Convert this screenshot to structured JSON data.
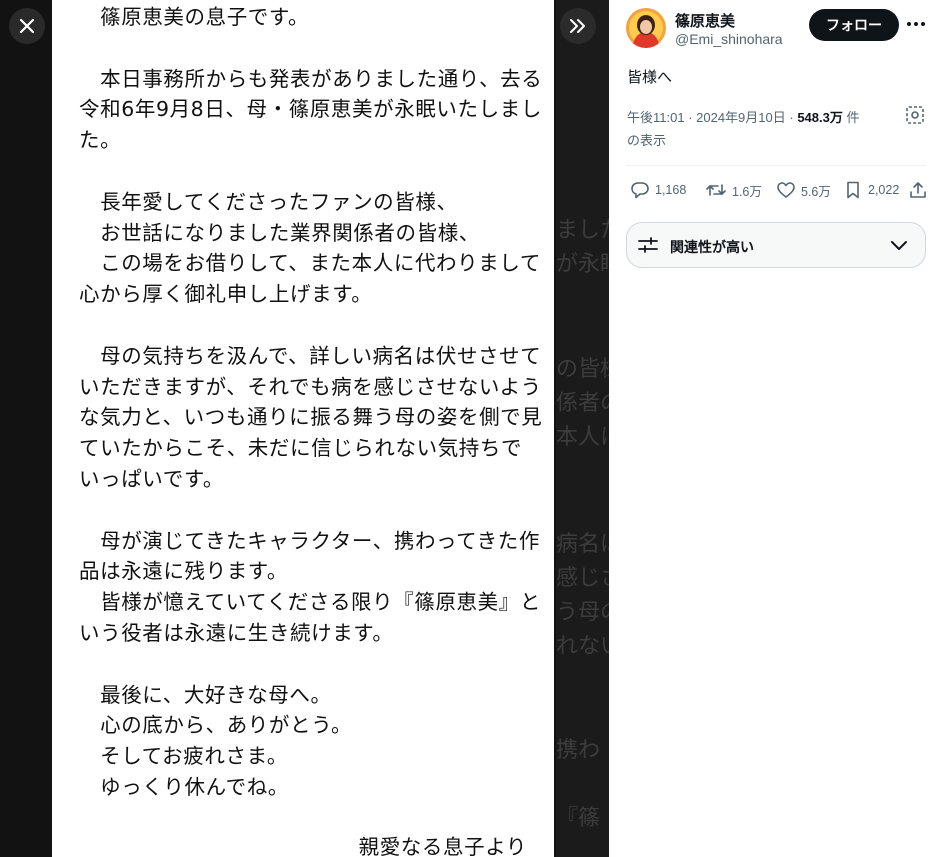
{
  "viewer": {
    "document_lines": [
      "　篠原恵美の息子です。",
      "",
      "　本日事務所からも発表がありました通り、去る",
      "令和6年9月8日、母・篠原恵美が永眠いたしまし",
      "た。",
      "",
      "　長年愛してくださったファンの皆様、",
      "　お世話になりました業界関係者の皆様、",
      "　この場をお借りして、また本人に代わりまして",
      "心から厚く御礼申し上げます。",
      "",
      "　母の気持ちを汲んで、詳しい病名は伏せさせて",
      "いただきますが、それでも病を感じさせないよう",
      "な気力と、いつも通りに振る舞う母の姿を側で見",
      "ていたからこそ、未だに信じられない気持ちで",
      "いっぱいです。",
      "",
      "　母が演じてきたキャラクター、携わってきた作",
      "品は永遠に残ります。",
      "　皆様が憶えていてくださる限り『篠原恵美』と",
      "いう役者は永遠に生き続けます。",
      "",
      "　最後に、大好きな母へ。",
      "　心の底から、ありがとう。",
      "　そしてお疲れさま。",
      "　ゆっくり休んでね。"
    ],
    "signature": "親愛なる息子より"
  },
  "post": {
    "display_name": "篠原恵美",
    "handle": "@Emi_shinohara",
    "follow_label": "フォロー",
    "text": "皆様へ",
    "time": "午後11:01",
    "date": "2024年9月10日",
    "views": "548.3万",
    "views_suffix_line1": "件",
    "views_suffix_line2": "の表示",
    "replies": "1,168",
    "reposts": "1.6万",
    "likes": "5.6万",
    "bookmarks": "2,022",
    "sort_label": "関連性が高い"
  },
  "colors": {
    "viewer_background": "#121212",
    "follow_button": "#0f1419",
    "secondary_text": "#536471"
  }
}
